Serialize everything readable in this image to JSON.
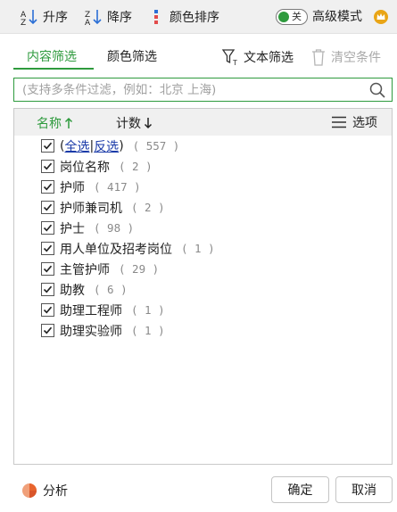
{
  "toolbar": {
    "sort_asc_label": "升序",
    "sort_desc_label": "降序",
    "color_sort_label": "颜色排序",
    "toggle_state_label": "关",
    "advanced_mode_label": "高级模式",
    "colors": {
      "accent": "#2e9a3d",
      "crown": "#e9a516"
    }
  },
  "tabs": [
    {
      "label": "内容筛选",
      "active": true
    },
    {
      "label": "颜色筛选",
      "active": false
    }
  ],
  "actions": {
    "text_filter_label": "文本筛选",
    "clear_filter_label": "清空条件"
  },
  "search": {
    "value": "",
    "placeholder": "(支持多条件过滤，例如：北京 上海)"
  },
  "list": {
    "header": {
      "name_label": "名称",
      "count_label": "计数",
      "options_label": "选项"
    },
    "select_all": {
      "open_paren": "(",
      "select_all_label": "全选",
      "separator": "|",
      "invert_label": "反选",
      "close_paren": ")",
      "count": "( 557 )",
      "checked": true
    },
    "items": [
      {
        "label": "岗位名称",
        "count": "( 2 )",
        "checked": true
      },
      {
        "label": "护师",
        "count": "( 417 )",
        "checked": true
      },
      {
        "label": "护师兼司机",
        "count": "( 2 )",
        "checked": true
      },
      {
        "label": "护士",
        "count": "( 98 )",
        "checked": true
      },
      {
        "label": "用人单位及招考岗位",
        "count": "( 1 )",
        "checked": true
      },
      {
        "label": "主管护师",
        "count": "( 29 )",
        "checked": true
      },
      {
        "label": "助教",
        "count": "( 6 )",
        "checked": true
      },
      {
        "label": "助理工程师",
        "count": "( 1 )",
        "checked": true
      },
      {
        "label": "助理实验师",
        "count": "( 1 )",
        "checked": true
      }
    ]
  },
  "footer": {
    "analyze_label": "分析",
    "ok_label": "确定",
    "cancel_label": "取消"
  }
}
